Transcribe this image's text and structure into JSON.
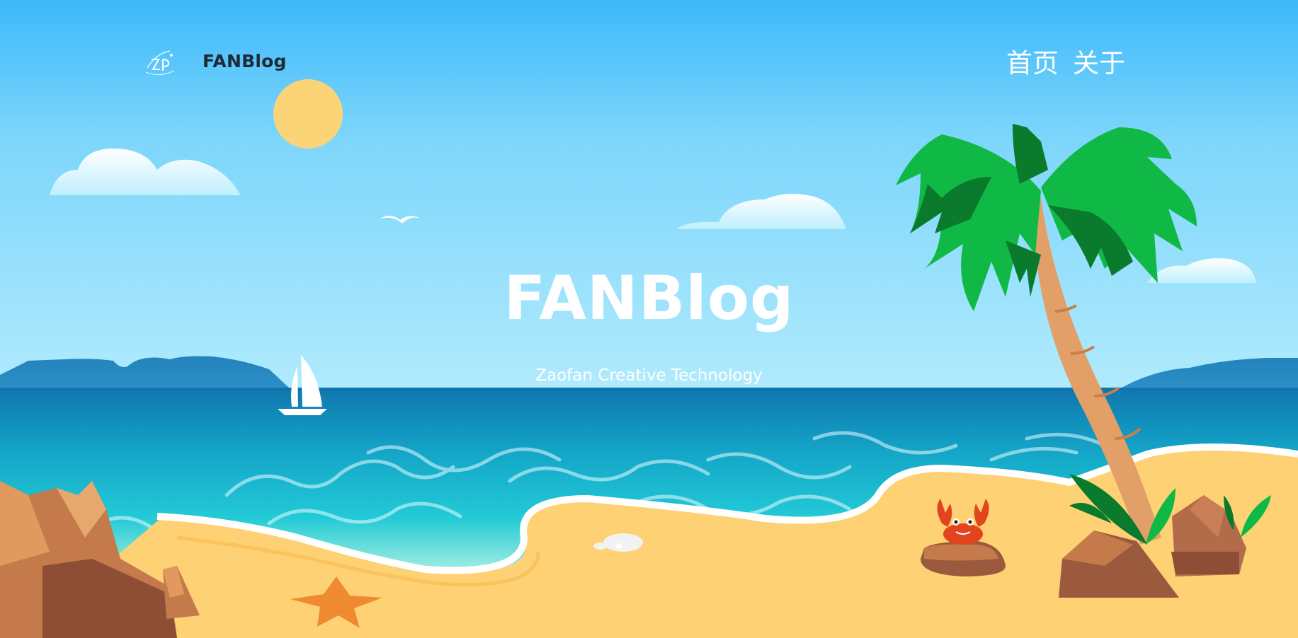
{
  "nav": {
    "logo_icon": "zaofan-logo-icon",
    "brand": "FANBlog",
    "menu": [
      {
        "label": "首页"
      },
      {
        "label": "关于"
      }
    ]
  },
  "hero": {
    "title": "FANBlog",
    "subtitle": "Zaofan Creative Technology"
  },
  "colors": {
    "sky_top": "#3DB9FB",
    "sky_bottom": "#A7E8FC",
    "sun": "#FCD478",
    "sea_deep": "#127EB5",
    "sea_shallow": "#20C8D6",
    "sand": "#FDD174",
    "palm_leaf": "#10B945",
    "palm_trunk": "#E2A068"
  }
}
